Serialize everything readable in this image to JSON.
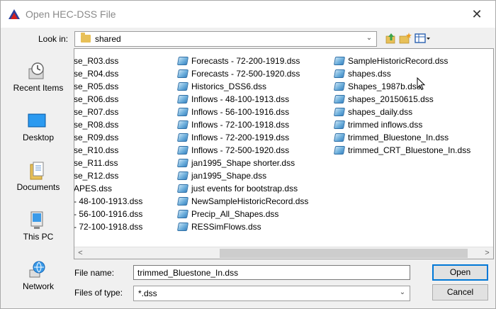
{
  "window": {
    "title": "Open HEC-DSS File",
    "close_glyph": "✕"
  },
  "lookin": {
    "label": "Look in:",
    "value": "shared"
  },
  "places": [
    {
      "label": "Recent Items",
      "icon": "recent-items-icon"
    },
    {
      "label": "Desktop",
      "icon": "desktop-icon"
    },
    {
      "label": "Documents",
      "icon": "documents-icon"
    },
    {
      "label": "This PC",
      "icon": "this-pc-icon"
    },
    {
      "label": "Network",
      "icon": "network-icon"
    }
  ],
  "files": {
    "col1": [
      "se_R03.dss",
      "se_R04.dss",
      "se_R05.dss",
      "se_R06.dss",
      "se_R07.dss",
      "se_R08.dss",
      "se_R09.dss",
      "se_R10.dss",
      "se_R11.dss",
      "se_R12.dss",
      "APES.dss",
      "- 48-100-1913.dss",
      "- 56-100-1916.dss",
      "- 72-100-1918.dss"
    ],
    "col2": [
      "Forecasts - 72-200-1919.dss",
      "Forecasts - 72-500-1920.dss",
      "Historics_DSS6.dss",
      "Inflows - 48-100-1913.dss",
      "Inflows - 56-100-1916.dss",
      "Inflows - 72-100-1918.dss",
      "Inflows - 72-200-1919.dss",
      "Inflows - 72-500-1920.dss",
      "jan1995_Shape shorter.dss",
      "jan1995_Shape.dss",
      "just events for bootstrap.dss",
      "NewSampleHistoricRecord.dss",
      "Precip_All_Shapes.dss",
      "RESSimFlows.dss"
    ],
    "col3": [
      "SampleHistoricRecord.dss",
      "shapes.dss",
      "Shapes_1987b.dss",
      "shapes_20150615.dss",
      "shapes_daily.dss",
      "trimmed inflows.dss",
      "trimmed_Bluestone_In.dss",
      "trimmed_CRT_Bluestone_In.dss"
    ]
  },
  "filename": {
    "label": "File name:",
    "value": "trimmed_Bluestone_In.dss"
  },
  "filetype": {
    "label": "Files of type:",
    "value": "*.dss"
  },
  "buttons": {
    "open": "Open",
    "cancel": "Cancel"
  },
  "scroll": {
    "left": "<",
    "right": ">"
  },
  "colors": {
    "accent": "#0078d7",
    "file_icon": "#3b86c4",
    "folder": "#e8c058"
  }
}
